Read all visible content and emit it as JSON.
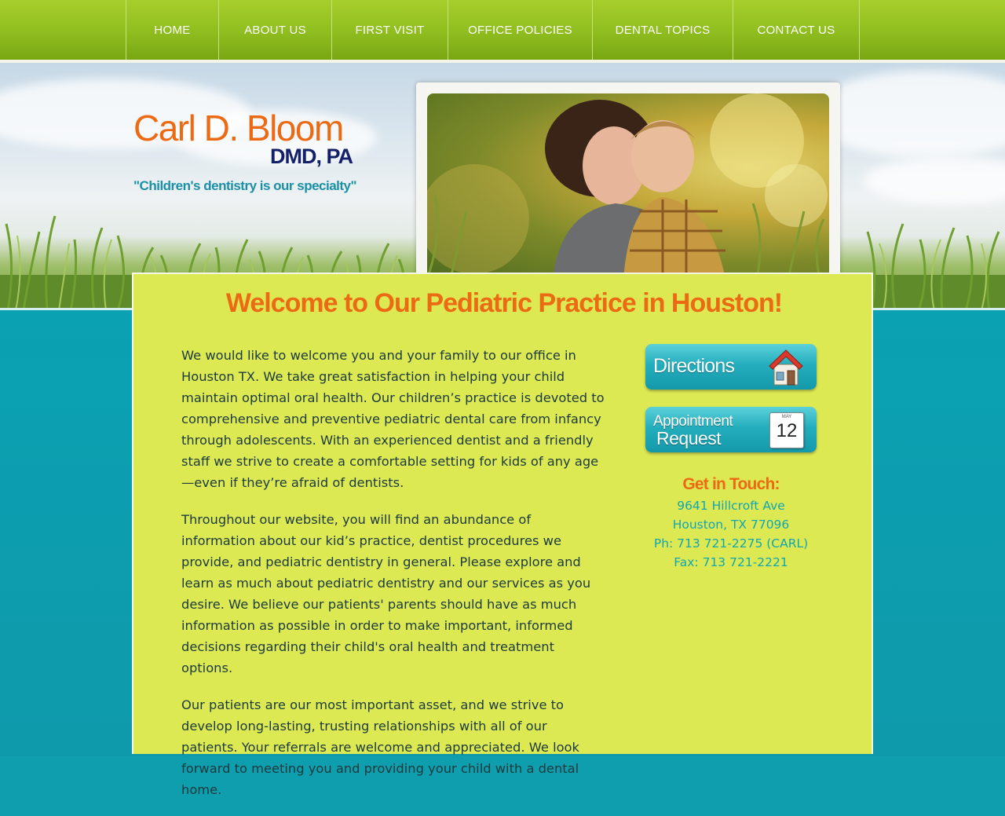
{
  "nav": {
    "items": [
      {
        "label": "HOME"
      },
      {
        "label": "ABOUT US"
      },
      {
        "label": "FIRST VISIT"
      },
      {
        "label": "OFFICE POLICIES"
      },
      {
        "label": "DENTAL TOPICS"
      },
      {
        "label": "CONTACT US"
      }
    ]
  },
  "brand": {
    "name": "Carl D. Bloom",
    "credentials": "DMD, PA",
    "tagline": "\"Children's dentistry is our specialty\""
  },
  "main": {
    "title": "Welcome to Our Pediatric Practice in Houston!",
    "paragraphs": [
      "We would like to welcome you and your family to our office in Houston TX. We take great satisfaction in helping your child maintain optimal oral health. Our children’s practice is devoted to comprehensive and preventive pediatric dental care from infancy through adolescents. With an experienced dentist and a friendly staff we strive to create a comfortable setting for kids of any age—even if they’re afraid of dentists.",
      "Throughout our website, you will find an abundance of information about our kid’s practice, dentist procedures we provide, and pediatric dentistry in general. Please explore and learn as much about pediatric dentistry and our services as you desire. We believe our patients' parents should have as much information as possible in order to make important, informed decisions regarding their child's oral health and treatment options.",
      "Our patients are our most important asset, and we strive to develop long-lasting, trusting relationships with all of our patients. Your referrals are welcome and appreciated. We look forward to meeting you and providing your child with a dental home."
    ]
  },
  "sidebar": {
    "directions_label": "Directions",
    "appointment_line1": "Appointment",
    "appointment_line2": "Request",
    "calendar_month": "MAY",
    "calendar_day": "12",
    "contact_heading": "Get in Touch:",
    "address_line1": "9641 Hillcroft Ave",
    "address_line2": "Houston, TX 77096",
    "phone": "Ph: 713 721-2275 (CARL)",
    "fax": "Fax: 713 721-2221"
  },
  "colors": {
    "nav_green": "#8fbd1f",
    "panel_lime": "#dde953",
    "accent_orange": "#ec6a14",
    "teal": "#0f9eae",
    "navy": "#15206b"
  },
  "icons": {
    "directions": "house-icon",
    "appointment": "calendar-icon"
  }
}
